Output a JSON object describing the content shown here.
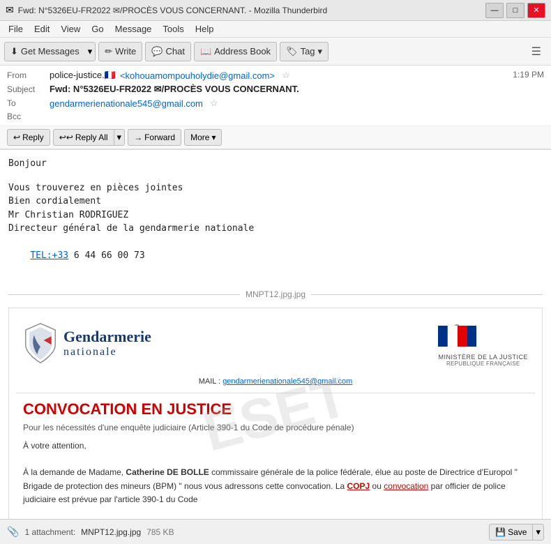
{
  "titlebar": {
    "title": "Fwd: N°5326EU-FR2022 ✉/PROCÈS VOUS CONCERNANT. - Mozilla Thunderbird",
    "icon": "✉",
    "minimize": "—",
    "maximize": "□",
    "close": "✕"
  },
  "menubar": {
    "items": [
      "File",
      "Edit",
      "View",
      "Go",
      "Message",
      "Tools",
      "Help"
    ]
  },
  "toolbar": {
    "get_messages": "Get Messages",
    "write": "Write",
    "chat": "Chat",
    "address_book": "Address Book",
    "tag": "Tag"
  },
  "email": {
    "from_label": "From",
    "from_name": "police-justice.🇫🇷",
    "from_email": "<kohouamompouholydie@gmail.com>",
    "subject_label": "Subject",
    "subject": "Fwd: N°5326EU-FR2022 ✉/PROCÈS VOUS CONCERNANT.",
    "to_label": "To",
    "to_email": "gendarmerienationale545@gmail.com",
    "bcc_label": "Bcc",
    "timestamp": "1:19 PM"
  },
  "reply_buttons": {
    "reply": "Reply",
    "reply_all": "Reply All",
    "forward": "Forward",
    "more": "More"
  },
  "body": {
    "greeting": "Bonjour",
    "text": "Vous trouverez en pièces jointes\nBien cordialement\nMr Christian RODRIGUEZ\nDirecteur général de la gendarmerie nationale",
    "tel_label": "TEL:+33",
    "tel_number": " 6 44 66 00 73"
  },
  "attachment_divider": "MNPT12.jpg.jpg",
  "embedded": {
    "gendarmerie_main": "Gendarmerie",
    "gendarmerie_sub": "nationale",
    "mail_label": "MAIL :",
    "mail_address": "gendarmerienationale545@gmail.com",
    "ministere_line1": "MINISTÈRE de la JUSTICE",
    "ministere_line2": "REPUBLIQUE FRANÇAISE",
    "convocation_title": "CONVOCATION EN JUSTICE",
    "convocation_subtitle": "Pour les nécessités d'une enquête judiciaire (Article 390-1 du Code de procédure pénale)",
    "attention": "À votre attention,",
    "body_text": "À la demande de Madame, ",
    "person_bold": "Catherine DE BOLLE",
    "body_text2": " commissaire générale de la police fédérale, élue au poste de Directrice d'Europol \" Brigade de protection des mineurs (BPM) \" nous vous adressons cette convocation. La ",
    "copj": "COPJ",
    "body_text3": " ou ",
    "convocation_word": "convocation",
    "body_text4": " par officier de police judiciaire est prévue par l'article 390-1 du Code"
  },
  "footer": {
    "attachment_count": "1 attachment:",
    "attachment_name": "MNPT12.jpg.jpg",
    "attachment_size": "785 KB",
    "save_label": "Save"
  },
  "watermark": "ESET"
}
